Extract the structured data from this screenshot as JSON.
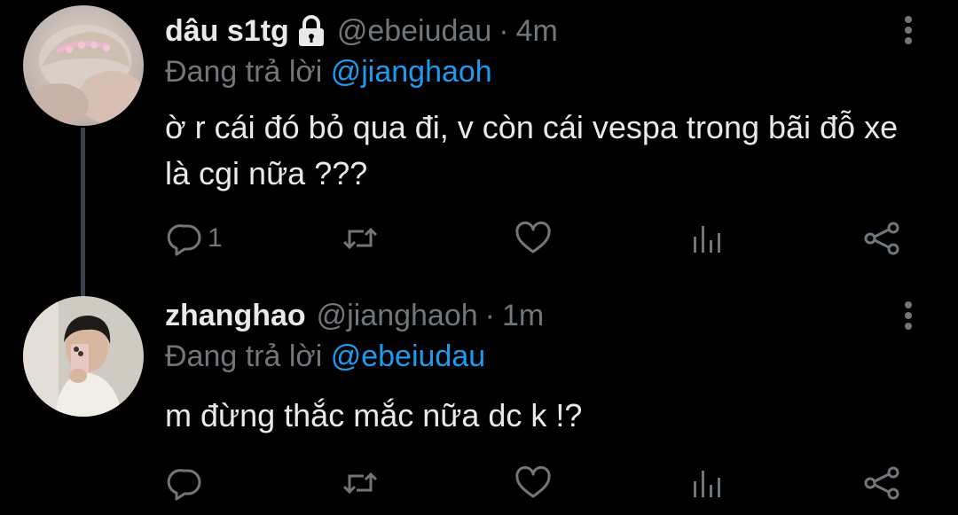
{
  "tweets": [
    {
      "display_name": "dâu s1tg",
      "protected": true,
      "handle": "@ebeiudau",
      "separator": "·",
      "time": "4m",
      "reply_prefix": "Đang trả lời",
      "reply_to": "@jianghaoh",
      "text": "ờ r cái đó bỏ qua đi, v còn cái vespa trong bãi đỗ xe là cgi nữa ???",
      "reply_count": "1"
    },
    {
      "display_name": "zhanghao",
      "protected": false,
      "handle": "@jianghaoh",
      "separator": "·",
      "time": "1m",
      "reply_prefix": "Đang trả lời",
      "reply_to": "@ebeiudau",
      "text": "m đừng thắc mắc nữa dc k !?",
      "reply_count": ""
    }
  ],
  "colors": {
    "background": "#000000",
    "text_primary": "#e7e9ea",
    "text_secondary": "#71767b",
    "accent": "#1d9bf0",
    "thread_line": "#38444d"
  }
}
